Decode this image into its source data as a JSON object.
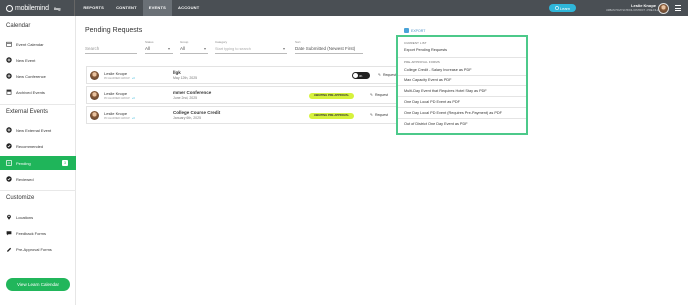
{
  "topbar": {
    "logo_bold": "mobilemind",
    "logo_suffix": "llog",
    "nav": [
      "REPORTS",
      "CONTENT",
      "EVENTS",
      "ACCOUNT"
    ],
    "active_nav": "EVENTS",
    "learn_label": "Learn",
    "user_name": "Leslie Knope",
    "user_org": "URBAN HIGH SCHOOL DISTRICT • PRE-FILLED PDE",
    "colors": {
      "bar": "#4a4f54",
      "learn": "#2fb6d9"
    }
  },
  "sidebar": {
    "calendar_title": "Calendar",
    "calendar_items": [
      "Event Calendar",
      "New Event",
      "New Conference",
      "Archived Events"
    ],
    "external_title": "External Events",
    "external_items": [
      "New External Event",
      "Recommended",
      "Pending",
      "Reviewed"
    ],
    "pending_count": "3",
    "customize_title": "Customize",
    "customize_items": [
      "Locations",
      "Feedback Forms",
      "Pre-Approval Forms"
    ],
    "view_calendar": "View Learn Calendar",
    "accent": "#1fb55a"
  },
  "main": {
    "title": "Pending Requests",
    "search_placeholder": "Search",
    "filters": {
      "status_label": "Status",
      "status_value": "All",
      "group_label": "Group",
      "group_value": "All",
      "category_label": "Category",
      "category_placeholder": "Start typing to search",
      "sort_label": "Sort",
      "sort_value": "Date Submitted (Newest First)"
    },
    "export_label": "EXPORT",
    "rows": [
      {
        "name": "Leslie Knope",
        "tag": "PD LEARNER GROUP",
        "tag_count": "+3",
        "event": "llgk",
        "date": "May 12th, 2025",
        "pill": "",
        "toggle": "3h",
        "action": "Request"
      },
      {
        "name": "Leslie Knope",
        "tag": "PD LEARNER GROUP",
        "tag_count": "+3",
        "event": "mmer Conference",
        "date": "June 2nd, 2025",
        "pill": "AWAITING PRE-APPROVAL",
        "toggle": "",
        "action": "Request"
      },
      {
        "name": "Leslie Knope",
        "tag": "PD LEARNER GROUP",
        "tag_count": "+3",
        "event": "College Course Credit",
        "date": "January 6th, 2025",
        "pill": "AWAITING PRE-APPROVAL",
        "toggle": "",
        "action": "Request"
      }
    ]
  },
  "export_menu": {
    "current_list_label": "CURRENT LIST",
    "current_list_items": [
      "Export Pending Requests"
    ],
    "forms_label": "PRE-APPROVAL FORMS",
    "form_items": [
      "College Credit - Salary Increase as PDF",
      "Max Capacity Event as PDF",
      "Multi-Day Event that Requires Hotel Stay as PDF",
      "One Day Local PD Event as PDF",
      "One Day Local PD Event (Requires Pre-Payment) as PDF",
      "Out of District One Day Event as PDF"
    ],
    "border_color": "#4cc98a"
  }
}
